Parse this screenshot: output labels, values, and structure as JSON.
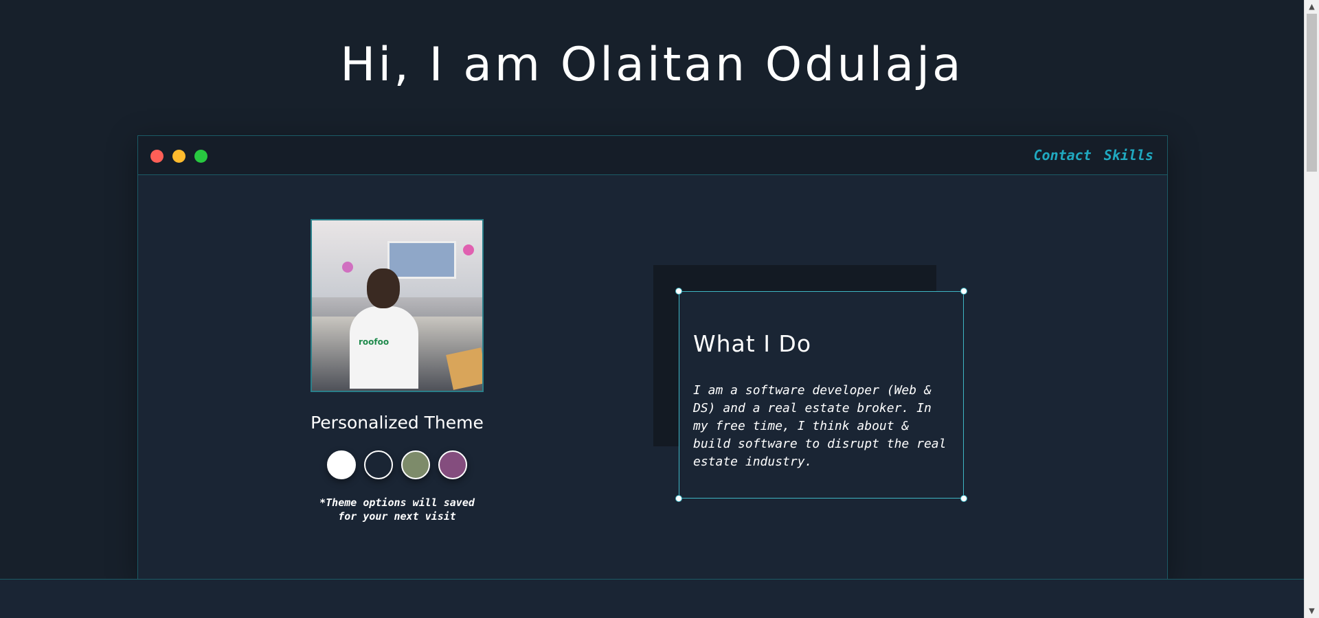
{
  "header": {
    "title": "Hi, I am Olaitan Odulaja"
  },
  "window": {
    "nav": [
      {
        "label": "Contact"
      },
      {
        "label": "Skills"
      }
    ],
    "controls": {
      "close_color": "#fe5f57",
      "minimize_color": "#febb2e",
      "maximize_color": "#28c840"
    }
  },
  "profile": {
    "photo_logo_text": "roofoo",
    "theme_title": "Personalized Theme",
    "themes": [
      {
        "name": "white",
        "color": "#ffffff"
      },
      {
        "name": "dark",
        "color": "#1a2534"
      },
      {
        "name": "sage",
        "color": "#7d8b6a"
      },
      {
        "name": "plum",
        "color": "#844d7e"
      }
    ],
    "theme_note": "*Theme options will saved for your next visit"
  },
  "about": {
    "heading": "What I Do",
    "body": "I am a software developer (Web & DS) and a real estate broker. In my free time, I think about & build software to disrupt the real estate industry."
  },
  "colors": {
    "background": "#17202b",
    "accent": "#20a9c0",
    "border": "#1b5b66"
  }
}
